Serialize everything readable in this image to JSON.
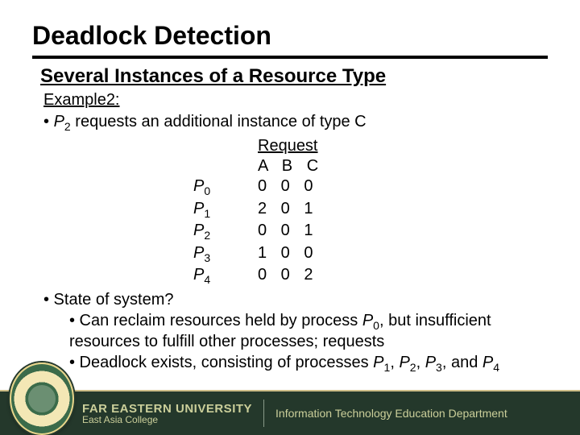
{
  "title": "Deadlock Detection",
  "subtitle": "Several Instances of a Resource Type",
  "example_label": "Example2:",
  "bullet_intro": {
    "prefix": "•",
    "proc": "P",
    "sub": "2",
    "rest": " requests an additional instance of type C"
  },
  "request_table": {
    "header": "Request",
    "cols": "A B C",
    "rows": [
      {
        "proc": "P",
        "sub": "0",
        "vals": "0 0 0"
      },
      {
        "proc": "P",
        "sub": "1",
        "vals": "2 0 1"
      },
      {
        "proc": "P",
        "sub": "2",
        "vals": "0 0 1"
      },
      {
        "proc": "P",
        "sub": "3",
        "vals": "1 0 0"
      },
      {
        "proc": "P",
        "sub": "4",
        "vals": "0 0 2"
      }
    ]
  },
  "state_question": "• State of system?",
  "reclaim_line": {
    "prefix": "• Can reclaim resources held by process ",
    "proc": "P",
    "sub": "0",
    "suffix": ", but insufficient resources to fulfill other processes; requests"
  },
  "deadlock_line": {
    "prefix": "• Deadlock exists, consisting of processes ",
    "procs": [
      {
        "p": "P",
        "s": "1"
      },
      {
        "p": "P",
        "s": "2"
      },
      {
        "p": "P",
        "s": "3"
      },
      {
        "p": "P",
        "s": "4"
      }
    ],
    "sep": ", ",
    "last_sep": ", and ",
    "suffix": ""
  },
  "footer": {
    "university": "FAR EASTERN UNIVERSITY",
    "campus": "East Asia College",
    "department": "Information Technology Education Department"
  }
}
